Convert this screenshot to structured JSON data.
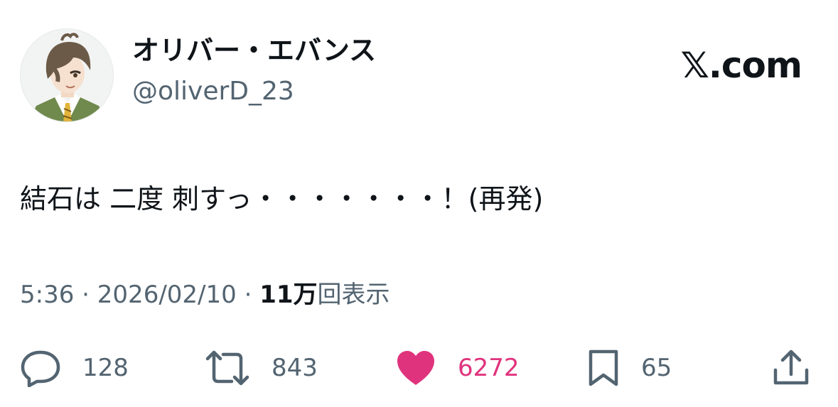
{
  "author": {
    "display_name": "オリバー・エバンス",
    "handle": "@oliverD_23",
    "avatar_icon": "anime-character-avatar"
  },
  "brand": {
    "label": "𝕏.com"
  },
  "tweet": {
    "text": "結石は 二度 刺すっ・・・・・・・！(再発)"
  },
  "meta": {
    "time": "5:36",
    "sep1": " · ",
    "date": "2026/02/10",
    "sep2": " · ",
    "views_count": "11万",
    "views_label": "回表示"
  },
  "actions": {
    "reply": {
      "icon": "reply-bubble-icon",
      "count": "128"
    },
    "repost": {
      "icon": "repost-icon",
      "count": "843"
    },
    "like": {
      "icon": "heart-icon",
      "count": "6272",
      "color": "#e0337d"
    },
    "bookmark": {
      "icon": "bookmark-icon",
      "count": "65"
    },
    "share": {
      "icon": "share-icon"
    }
  },
  "colors": {
    "text_primary": "#0f1419",
    "text_secondary": "#536471",
    "like_pink": "#e0337d"
  }
}
